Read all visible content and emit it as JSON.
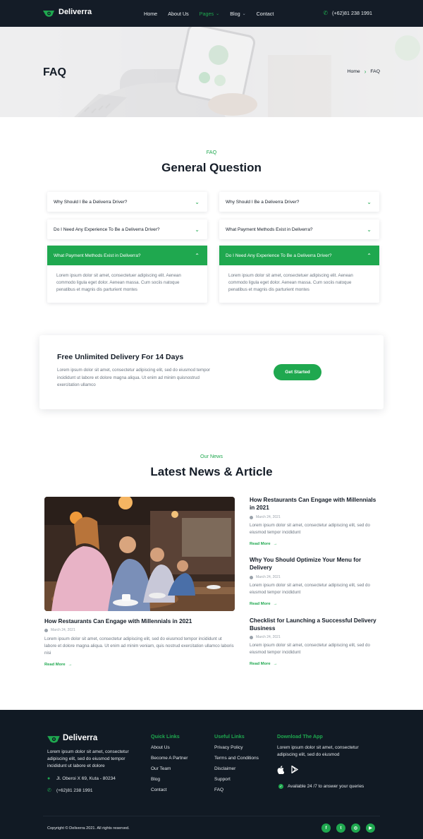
{
  "nav": {
    "brand": "Deliverra",
    "items": [
      {
        "label": "Home",
        "dropdown": false,
        "active": false
      },
      {
        "label": "About Us",
        "dropdown": false,
        "active": false
      },
      {
        "label": "Pages",
        "dropdown": true,
        "active": true
      },
      {
        "label": "Blog",
        "dropdown": true,
        "active": false
      },
      {
        "label": "Contact",
        "dropdown": false,
        "active": false
      }
    ],
    "phone": "(+62)81 238 1991"
  },
  "hero": {
    "title": "FAQ",
    "breadcrumb": [
      "Home",
      "FAQ"
    ]
  },
  "faq": {
    "eyebrow": "FAQ",
    "title": "General Question",
    "left": [
      {
        "question": "Why Should I Be a Deliverra Driver?",
        "open": false
      },
      {
        "question": "Do I Need Any Experience To Be a Deliverra Driver?",
        "open": false
      },
      {
        "question": "What Payment Methods Exist in Deliverra?",
        "open": true,
        "answer": "Lorem ipsum dolor sit amet, consectetuer adipiscing elit. Aenean commodo ligula eget dolor. Aenean massa. Cum sociis natoque penatibus et magnis dis parturient montes"
      }
    ],
    "right": [
      {
        "question": "Why Should I Be a Deliverra Driver?",
        "open": false
      },
      {
        "question": "What Payment Methods Exist in Deliverra?",
        "open": false
      },
      {
        "question": "Do I Need Any Experience To Be a Deliverra Driver?",
        "open": true,
        "answer": "Lorem ipsum dolor sit amet, consectetuer adipiscing elit. Aenean commodo ligula eget dolor. Aenean massa. Cum sociis natoque penatibus et magnis dis parturient montes"
      }
    ]
  },
  "cta": {
    "title": "Free Unlimited Delivery For 14 Days",
    "text": "Lorem ipsum dolor sit amet, consectetur adipiscing elit, sed do eiusmod tempor incididunt ut labore et dolore magna aliqua. Ut enim ad minim quisnostrud exercitation ullamco",
    "button": "Get Started"
  },
  "news": {
    "eyebrow": "Our News",
    "title": "Latest News & Article",
    "featured": {
      "title": "How Restaurants Can Engage with Millennials in 2021",
      "date": "March 24, 2021",
      "excerpt": "Lorem ipsum dolor sit amet, consectetur adipiscing elit, sed do eiusmod tempor incididunt ut labore et dolore magna aliqua. Ut enim ad minim veniam, quis nostrud exercitation ullamco laboris nisi",
      "read_more": "Read More"
    },
    "side": [
      {
        "title": "How Restaurants Can Engage with Millennials in 2021",
        "date": "March 24, 2021",
        "excerpt": "Lorem ipsum dolor sit amet, consectetur adipiscing elit, sed do eiusmod tempor incididunt",
        "read_more": "Read More"
      },
      {
        "title": "Why You Should Optimize Your Menu for Delivery",
        "date": "March 24, 2021",
        "excerpt": "Lorem ipsum dolor sit amet, consectetur adipiscing elit, sed do eiusmod tempor incididunt",
        "read_more": "Read More"
      },
      {
        "title": "Checklist for Launching a Successful Delivery Business",
        "date": "March 24, 2021",
        "excerpt": "Lorem ipsum dolor sit amet, consectetur adipiscing elit, sed do eiusmod tempor incididunt",
        "read_more": "Read More"
      }
    ]
  },
  "footer": {
    "brand": "Deliverra",
    "about": "Lorem ipsum dolor sit amet, consectetur adipiscing elit, sed do eiusmod tempor incididunt ut labore et dolore",
    "address": "Jl. Oberoi X 69, Kuta - 80234",
    "phone": "(+62)81 238 1991",
    "quick_links": {
      "title": "Quick Links",
      "items": [
        "About Us",
        "Become A Partner",
        "Our Team",
        "Blog",
        "Contact"
      ]
    },
    "useful_links": {
      "title": "Useful Links",
      "items": [
        "Privacy Policy",
        "Terms and Conditions",
        "Disclaimer",
        "Support",
        "FAQ"
      ]
    },
    "app": {
      "title": "Download The App",
      "text": "Lorem ipsum dolor sit amet, consectetur adipiscing elit, sed do eiusmod",
      "availability": "Available 24 /7 to answer your queries"
    },
    "copyright": "Copyright © Deliverra 2021. All rights reserved.",
    "social": [
      "facebook-icon",
      "twitter-icon",
      "instagram-icon",
      "youtube-icon"
    ]
  },
  "colors": {
    "accent": "#1fa84f",
    "dark": "#141c27",
    "footer": "#111a24"
  }
}
